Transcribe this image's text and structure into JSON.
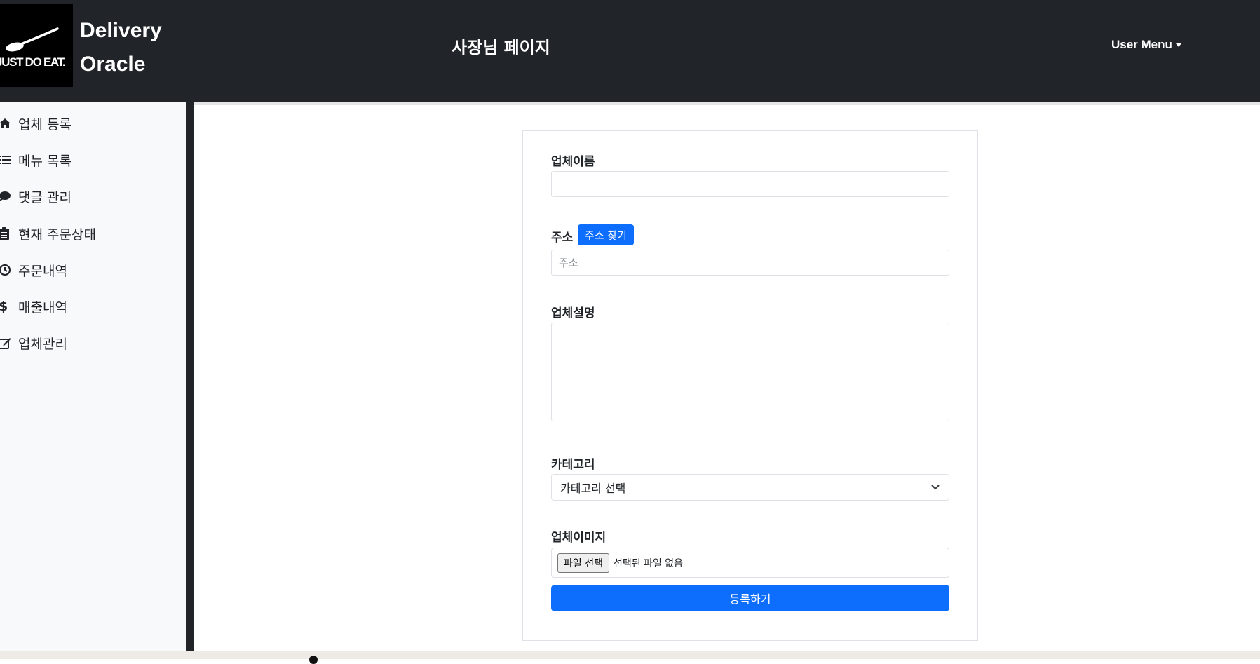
{
  "header": {
    "logo_text": "JUST DO EAT.",
    "brand_line1": "Delivery",
    "brand_line2": "Oracle",
    "page_title": "사장님 페이지",
    "user_menu": "User Menu"
  },
  "sidebar": {
    "items": [
      {
        "label": "업체 등록",
        "icon": "home-icon"
      },
      {
        "label": "메뉴 목록",
        "icon": "list-icon"
      },
      {
        "label": "댓글 관리",
        "icon": "comment-icon"
      },
      {
        "label": "현재 주문상태",
        "icon": "clipboard-icon"
      },
      {
        "label": "주문내역",
        "icon": "history-icon"
      },
      {
        "label": "매출내역",
        "icon": "dollar-icon"
      },
      {
        "label": "업체관리",
        "icon": "edit-icon"
      }
    ]
  },
  "form": {
    "name_label": "업체이름",
    "name_value": "",
    "address_label": "주소",
    "address_button": "주소 찾기",
    "address_placeholder": "주소",
    "description_label": "업체설명",
    "description_value": "",
    "category_label": "카테고리",
    "category_selected": "카테고리 선택",
    "image_label": "업체이미지",
    "file_button": "파일 선택",
    "file_status": "선택된 파일 없음",
    "submit_label": "등록하기"
  },
  "colors": {
    "header_bg": "#212529",
    "primary": "#0d6efd",
    "sidebar_bg": "#f8f9fa"
  }
}
